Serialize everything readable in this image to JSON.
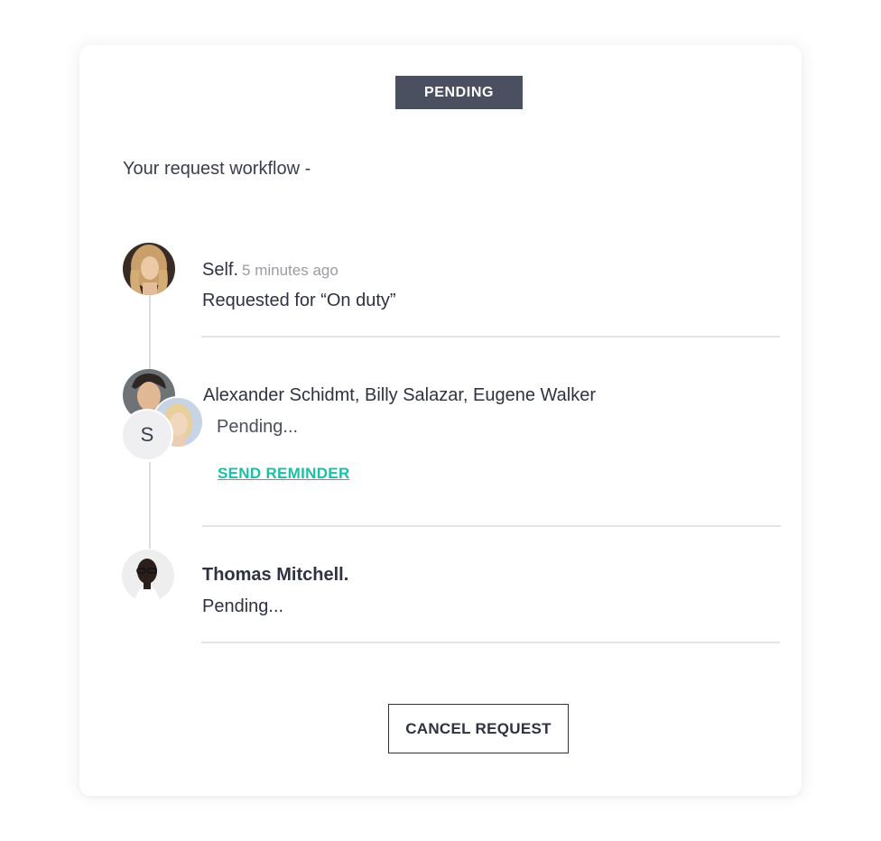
{
  "status": {
    "label": "PENDING"
  },
  "workflow": {
    "heading": "Your request workflow -",
    "steps": [
      {
        "actor": "Self.",
        "time": "5 minutes ago",
        "detail": "Requested for “On duty”"
      },
      {
        "actor": "Alexander Schidmt, Billy Salazar, Eugene Walker",
        "detail": "Pending...",
        "initial": "S",
        "action": "SEND REMINDER"
      },
      {
        "actor": "Thomas Mitchell.",
        "detail": "Pending..."
      }
    ]
  },
  "footer": {
    "cancel_label": "CANCEL REQUEST"
  },
  "colors": {
    "badge": "#4a5060",
    "accent": "#1bbfa5",
    "text": "#2f3242"
  }
}
